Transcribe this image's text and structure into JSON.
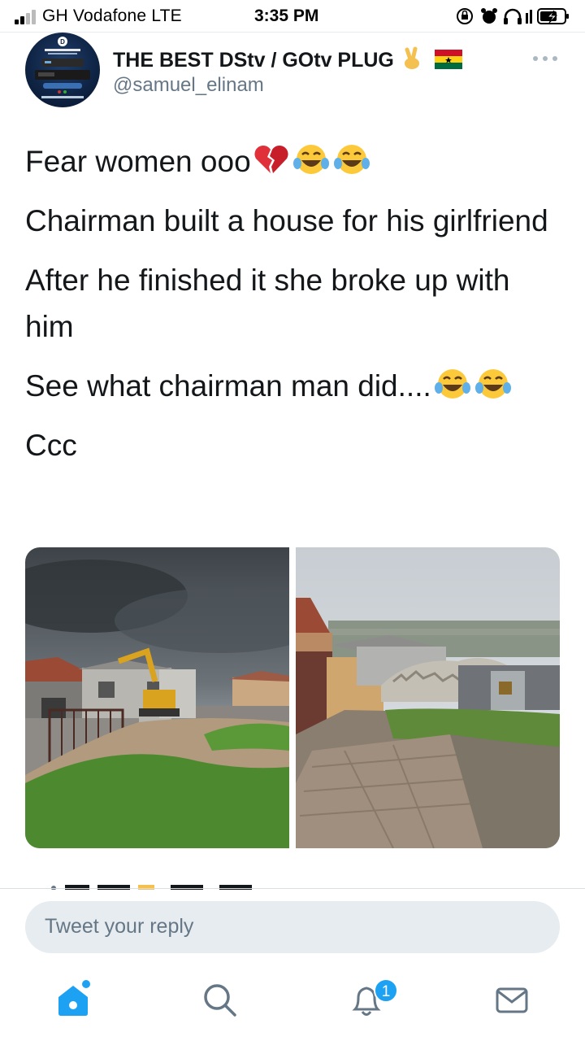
{
  "status_bar": {
    "carrier": "GH Vodafone  LTE",
    "time": "3:35 PM"
  },
  "tweet": {
    "display_name": "THE BEST DStv / GOtv PLUG",
    "handle": "@samuel_elinam",
    "lines": [
      "Fear women ooo",
      "Chairman built a house for his girlfriend",
      "After he finished it she broke up with him",
      "See what chairman man did....",
      "Ccc"
    ],
    "emojis": {
      "line1": [
        "broken-heart",
        "tears-of-joy",
        "tears-of-joy"
      ],
      "line4": [
        "tears-of-joy",
        "tears-of-joy"
      ]
    },
    "media": [
      "house-excavator-photo",
      "demolished-house-rubble-photo"
    ]
  },
  "reply": {
    "placeholder": "Tweet your reply"
  },
  "nav": {
    "notifications_badge": "1",
    "items": [
      "home-icon",
      "search-icon",
      "notifications-icon",
      "messages-icon"
    ]
  },
  "colors": {
    "accent": "#1da1f2",
    "text": "#14171a",
    "secondary": "#657786",
    "reply_bg": "#e6ecf0"
  }
}
